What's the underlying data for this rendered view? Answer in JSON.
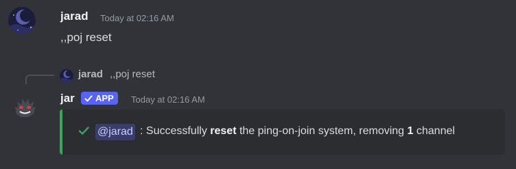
{
  "messages": [
    {
      "author": "jarad",
      "timestamp": "Today at 02:16 AM",
      "content": ",,poj reset",
      "avatar_icon": "moon-night-avatar-icon"
    },
    {
      "author": "jar",
      "badge": "APP",
      "timestamp": "Today at 02:16 AM",
      "avatar_icon": "gengar-avatar-icon",
      "reply": {
        "author": "jarad",
        "content": ",,poj reset"
      },
      "embed": {
        "accent_color": "#3ba55c",
        "status_icon": "checkmark-icon",
        "mention": "@jarad",
        "text_before": ": Successfully ",
        "bold_1": "reset",
        "text_middle": " the ping-on-join system, removing ",
        "bold_2": "1",
        "text_after": " channel"
      }
    }
  ]
}
